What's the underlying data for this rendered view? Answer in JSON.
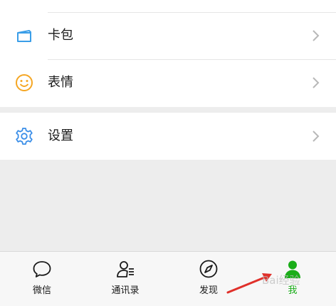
{
  "menu": {
    "items": [
      {
        "label": "卡包",
        "icon": "card-wallet-icon"
      },
      {
        "label": "表情",
        "icon": "smiley-icon"
      },
      {
        "label": "设置",
        "icon": "gear-icon"
      }
    ]
  },
  "tabbar": {
    "tabs": [
      {
        "label": "微信",
        "icon": "chat-bubble-icon",
        "active": false
      },
      {
        "label": "通讯录",
        "icon": "contacts-icon",
        "active": false
      },
      {
        "label": "发现",
        "icon": "compass-icon",
        "active": false
      },
      {
        "label": "我",
        "icon": "person-icon",
        "active": true
      }
    ]
  },
  "watermark": {
    "text": "Bai经验"
  },
  "colors": {
    "accent_green": "#1aad19",
    "card_icon_blue": "#3a9ee8",
    "smiley_orange": "#f5a623",
    "gear_blue": "#3a8ee8",
    "arrow_red": "#e0302a"
  }
}
